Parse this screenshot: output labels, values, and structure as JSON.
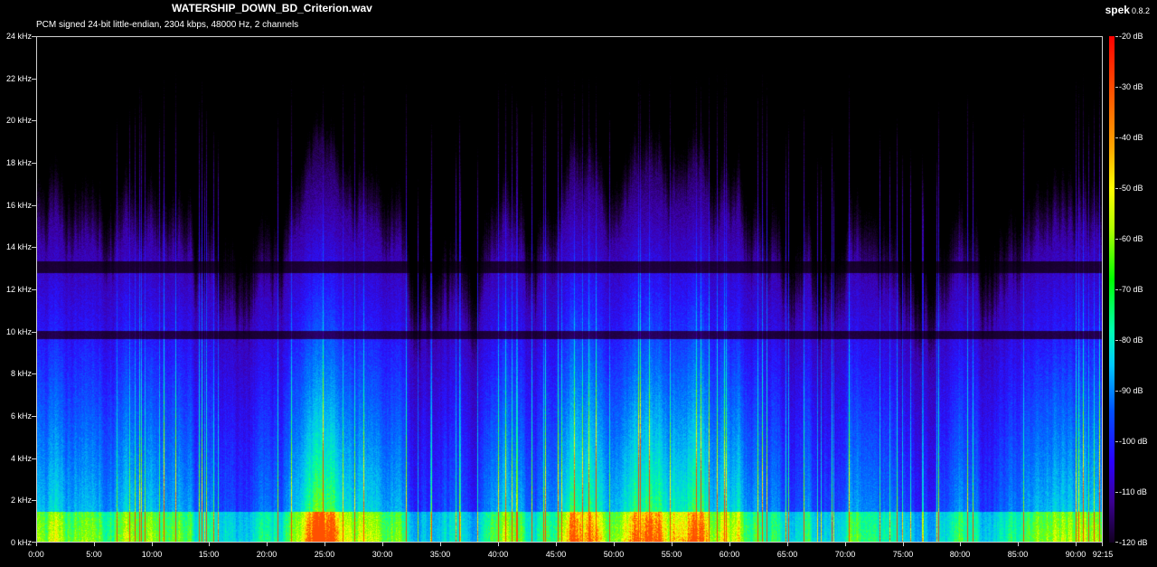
{
  "header": {
    "title": "WATERSHIP_DOWN_BD_Criterion.wav",
    "subtitle": "PCM signed 24-bit little-endian, 2304 kbps, 48000 Hz, 2 channels",
    "app_name": "spek",
    "app_version": "0.8.2"
  },
  "y_axis": {
    "labels": [
      "24 kHz",
      "22 kHz",
      "20 kHz",
      "18 kHz",
      "16 kHz",
      "14 kHz",
      "12 kHz",
      "10 kHz",
      "8 kHz",
      "6 kHz",
      "4 kHz",
      "2 kHz",
      "0 kHz"
    ]
  },
  "x_axis": {
    "labels": [
      "0:00",
      "5:00",
      "10:00",
      "15:00",
      "20:00",
      "25:00",
      "30:00",
      "35:00",
      "40:00",
      "45:00",
      "50:00",
      "55:00",
      "60:00",
      "65:00",
      "70:00",
      "75:00",
      "80:00",
      "85:00",
      "90:00",
      "92:15"
    ]
  },
  "colorbar": {
    "labels": [
      "-20 dB",
      "-30 dB",
      "-40 dB",
      "-50 dB",
      "-60 dB",
      "-70 dB",
      "-80 dB",
      "-90 dB",
      "-100 dB",
      "-110 dB",
      "-120 dB"
    ]
  },
  "colors": {
    "background": "#000000",
    "axis": "#d0d0d0",
    "text": "#ffffff"
  }
}
